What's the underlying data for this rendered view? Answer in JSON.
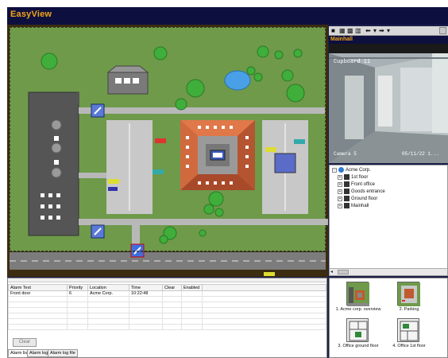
{
  "app": {
    "title": "EasyView"
  },
  "camera": {
    "title": "Mainhall",
    "overlay_top": "Cupboard 11",
    "overlay_camera": "Camera 5",
    "overlay_timestamp": "05/11/22 1..."
  },
  "toolbar": {
    "icons": [
      "grid-1x1-icon",
      "grid-2x2-icon",
      "grid-3x3-icon",
      "grid-4x4-icon",
      "back-arrow-icon",
      "forward-arrow-icon",
      "dropdown-icon"
    ],
    "glyphs": [
      "■",
      "▦",
      "▩",
      "▥",
      "⬅",
      "▾",
      "➡",
      "▾"
    ]
  },
  "tree": {
    "root": "Acme Corp.",
    "items": [
      "1st floor",
      "Front office",
      "Goods entrance",
      "Ground floor",
      "Mainhall"
    ]
  },
  "alarms": {
    "columns": [
      "Alarm Text",
      "Priority",
      "Location",
      "Time",
      "Clear",
      "Enabled"
    ],
    "rows": [
      [
        "Front door",
        "6",
        "Acme Corp.",
        "10:22:48",
        "",
        ""
      ]
    ],
    "clear_label": "Clear",
    "tabs": [
      "Alarm list",
      "Alarm log",
      "Alarm log file"
    ]
  },
  "thumbnails": [
    {
      "label": "1. Acme corp. overview",
      "icon": "overview-map-icon"
    },
    {
      "label": "2. Parking",
      "icon": "parking-map-icon"
    },
    {
      "label": "3. Office ground floor",
      "icon": "floorplan-icon"
    },
    {
      "label": "4. Office 1st floor",
      "icon": "floorplan-icon"
    }
  ],
  "colors": {
    "title_text": "#f2a516",
    "title_bar": "#0d0f3f",
    "map_grass": "#6e9a4a",
    "building_roof": "#d86a3c",
    "road": "#8a8a8a"
  }
}
